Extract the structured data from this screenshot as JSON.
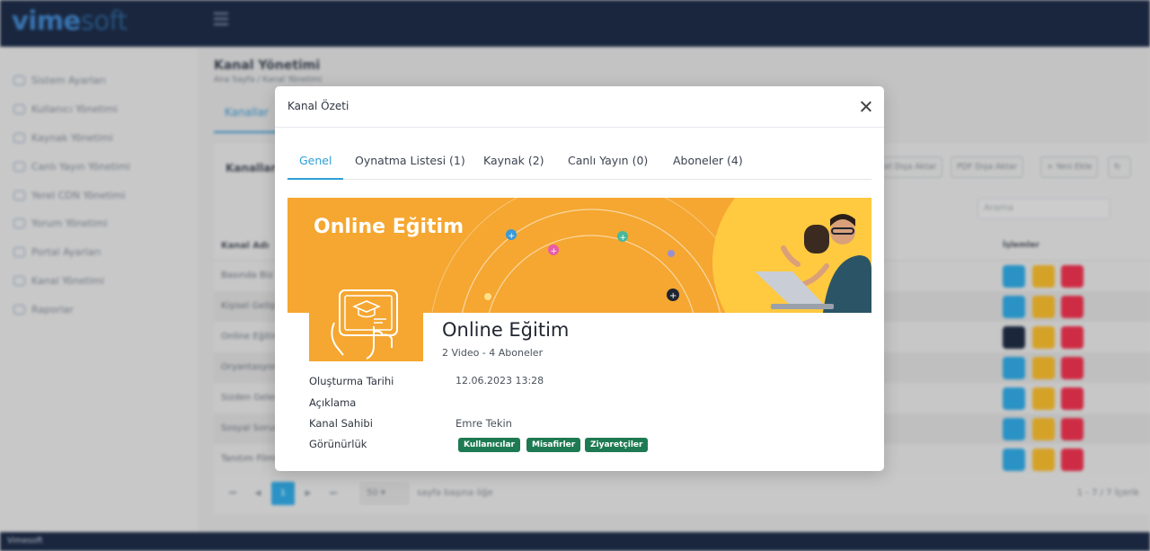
{
  "brand": {
    "main": "vime",
    "accent": "soft"
  },
  "sidebar": {
    "items": [
      {
        "label": "Sistem Ayarları"
      },
      {
        "label": "Kullanıcı Yönetimi"
      },
      {
        "label": "Kaynak Yönetimi"
      },
      {
        "label": "Canlı Yayın Yönetimi"
      },
      {
        "label": "Yerel CDN Yönetimi"
      },
      {
        "label": "Yorum Yönetimi"
      },
      {
        "label": "Portal Ayarları"
      },
      {
        "label": "Kanal Yönetimi"
      },
      {
        "label": "Raporlar"
      }
    ]
  },
  "page": {
    "title": "Kanal Yönetimi",
    "breadcrumb": "Ana Sayfa  /  Kanal Yönetimi",
    "tab": "Kanallar",
    "card_title": "Kanallar",
    "buttons": {
      "excel": "Excel Dışa Aktar",
      "pdf": "PDF Dışa Aktar",
      "add": "+ Yeni Ekle"
    },
    "search_placeholder": "Arama",
    "table": {
      "col_name": "Kanal Adı",
      "col_actions": "İşlemler",
      "rows": [
        "Basında Biz",
        "Kişisel Gelişim",
        "Online Eğitim",
        "Oryantasyon",
        "Sizden Gelenler",
        "Sosyal Sorumluluk",
        "Tanıtım Filmleri"
      ]
    },
    "pager": {
      "current": "1",
      "per_page": "50",
      "per_page_label": "sayfa başına öğe",
      "count": "1 - 7 / 7 İçerik"
    }
  },
  "footer": {
    "text": "Vimesoft"
  },
  "modal": {
    "title": "Kanal Özeti",
    "tabs": [
      {
        "label": "Genel",
        "active": true
      },
      {
        "label": "Oynatma Listesi (1)"
      },
      {
        "label": "Kaynak (2)"
      },
      {
        "label": "Canlı Yayın (0)"
      },
      {
        "label": "Aboneler (4)"
      }
    ],
    "banner_text": "Online Eğitim",
    "channel_name": "Online Eğitim",
    "channel_sub": "2 Video - 4 Aboneler",
    "info": {
      "created_label": "Oluşturma Tarihi",
      "created_value": "12.06.2023 13:28",
      "desc_label": "Açıklama",
      "desc_value": "",
      "owner_label": "Kanal Sahibi",
      "owner_value": "Emre Tekin",
      "visibility_label": "Görünürlük",
      "badges": [
        "Kullanıcılar",
        "Misafirler",
        "Ziyaretçiler"
      ]
    }
  },
  "colors": {
    "accent": "#2e9fd6",
    "banner": "#f5a731",
    "badge": "#1e7a52",
    "navy": "#1c2a44"
  }
}
